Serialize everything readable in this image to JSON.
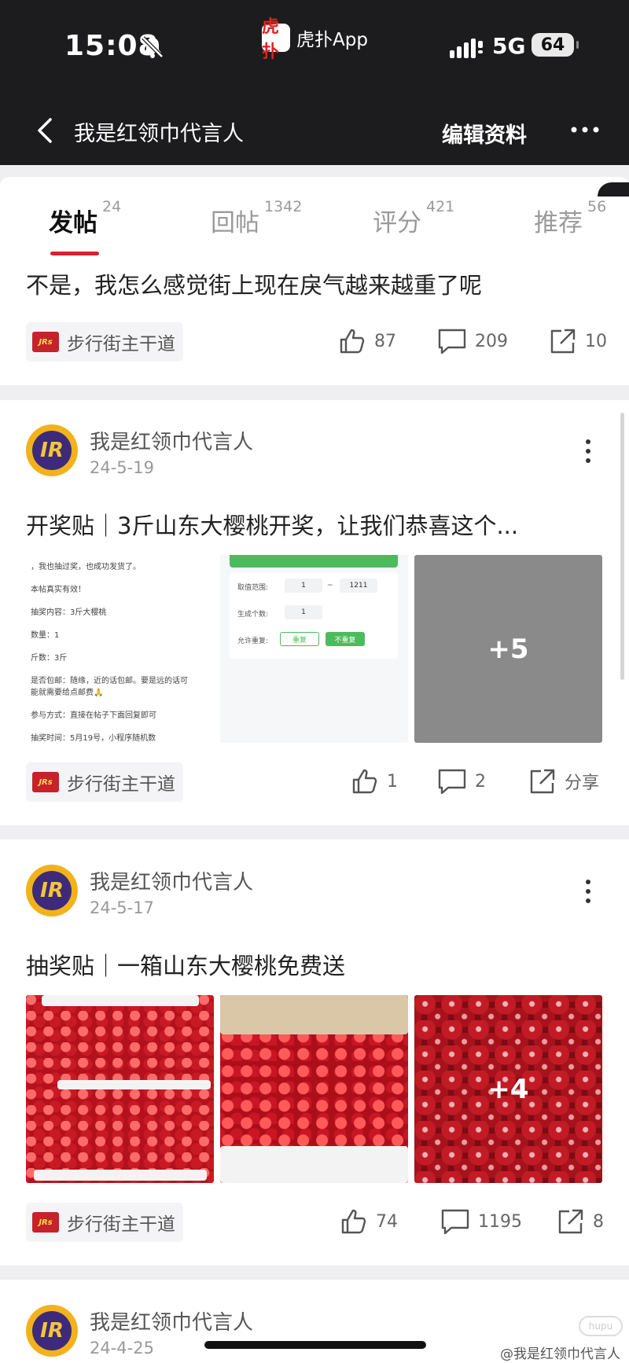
{
  "status": {
    "time": "15:08",
    "app_logo": "虎扑",
    "app_name": "虎扑App",
    "network": "5G",
    "battery": "64"
  },
  "nav": {
    "title": "我是红领巾代言人",
    "edit": "编辑资料"
  },
  "tabs": [
    {
      "label": "发帖",
      "count": "24"
    },
    {
      "label": "回帖",
      "count": "1342"
    },
    {
      "label": "评分",
      "count": "421"
    },
    {
      "label": "推荐",
      "count": "56"
    }
  ],
  "posts": [
    {
      "title": "不是，我怎么感觉街上现在戾气越来越重了呢",
      "forum": "步行街主干道",
      "likes": "87",
      "comments": "209",
      "shares": "10"
    },
    {
      "author": "我是红领巾代言人",
      "date": "24-5-19",
      "title": "开奖贴｜3斤山东大樱桃开奖，让我们恭喜这个...",
      "doc_lines": [
        "，我也抽过奖，也成功发货了。",
        "本帖真实有效！",
        "抽奖内容：3斤大樱桃",
        "数量：1",
        "斤数：3斤",
        "是否包邮：随缘，近的话包邮。要是远的话可",
        "能就需要给点邮费🙏",
        "参与方式：直接在帖子下面回复即可",
        "抽奖时间：5月19号，小程序随机数"
      ],
      "form": {
        "range_label": "取值范围:",
        "range_from": "1",
        "range_sep": "~",
        "range_to": "1211",
        "count_label": "生成个数:",
        "count_value": "1",
        "repeat_label": "允许重复:",
        "repeat_yes": "重复",
        "repeat_no": "不重复"
      },
      "more_images": "+5",
      "forum": "步行街主干道",
      "likes": "1",
      "comments": "2",
      "share_label": "分享"
    },
    {
      "author": "我是红领巾代言人",
      "date": "24-5-17",
      "title": "抽奖贴｜一箱山东大樱桃免费送",
      "more_images": "+4",
      "forum": "步行街主干道",
      "likes": "74",
      "comments": "1195",
      "shares": "8"
    },
    {
      "author": "我是红领巾代言人",
      "date": "24-4-25"
    }
  ],
  "avatar_text": "IR",
  "forum_logo_text": "JRs",
  "watermark": "@我是红领巾代言人",
  "colors": {
    "header_bg": "#1c1c1e",
    "accent": "#d9222a",
    "page_bg": "#efeff1"
  }
}
